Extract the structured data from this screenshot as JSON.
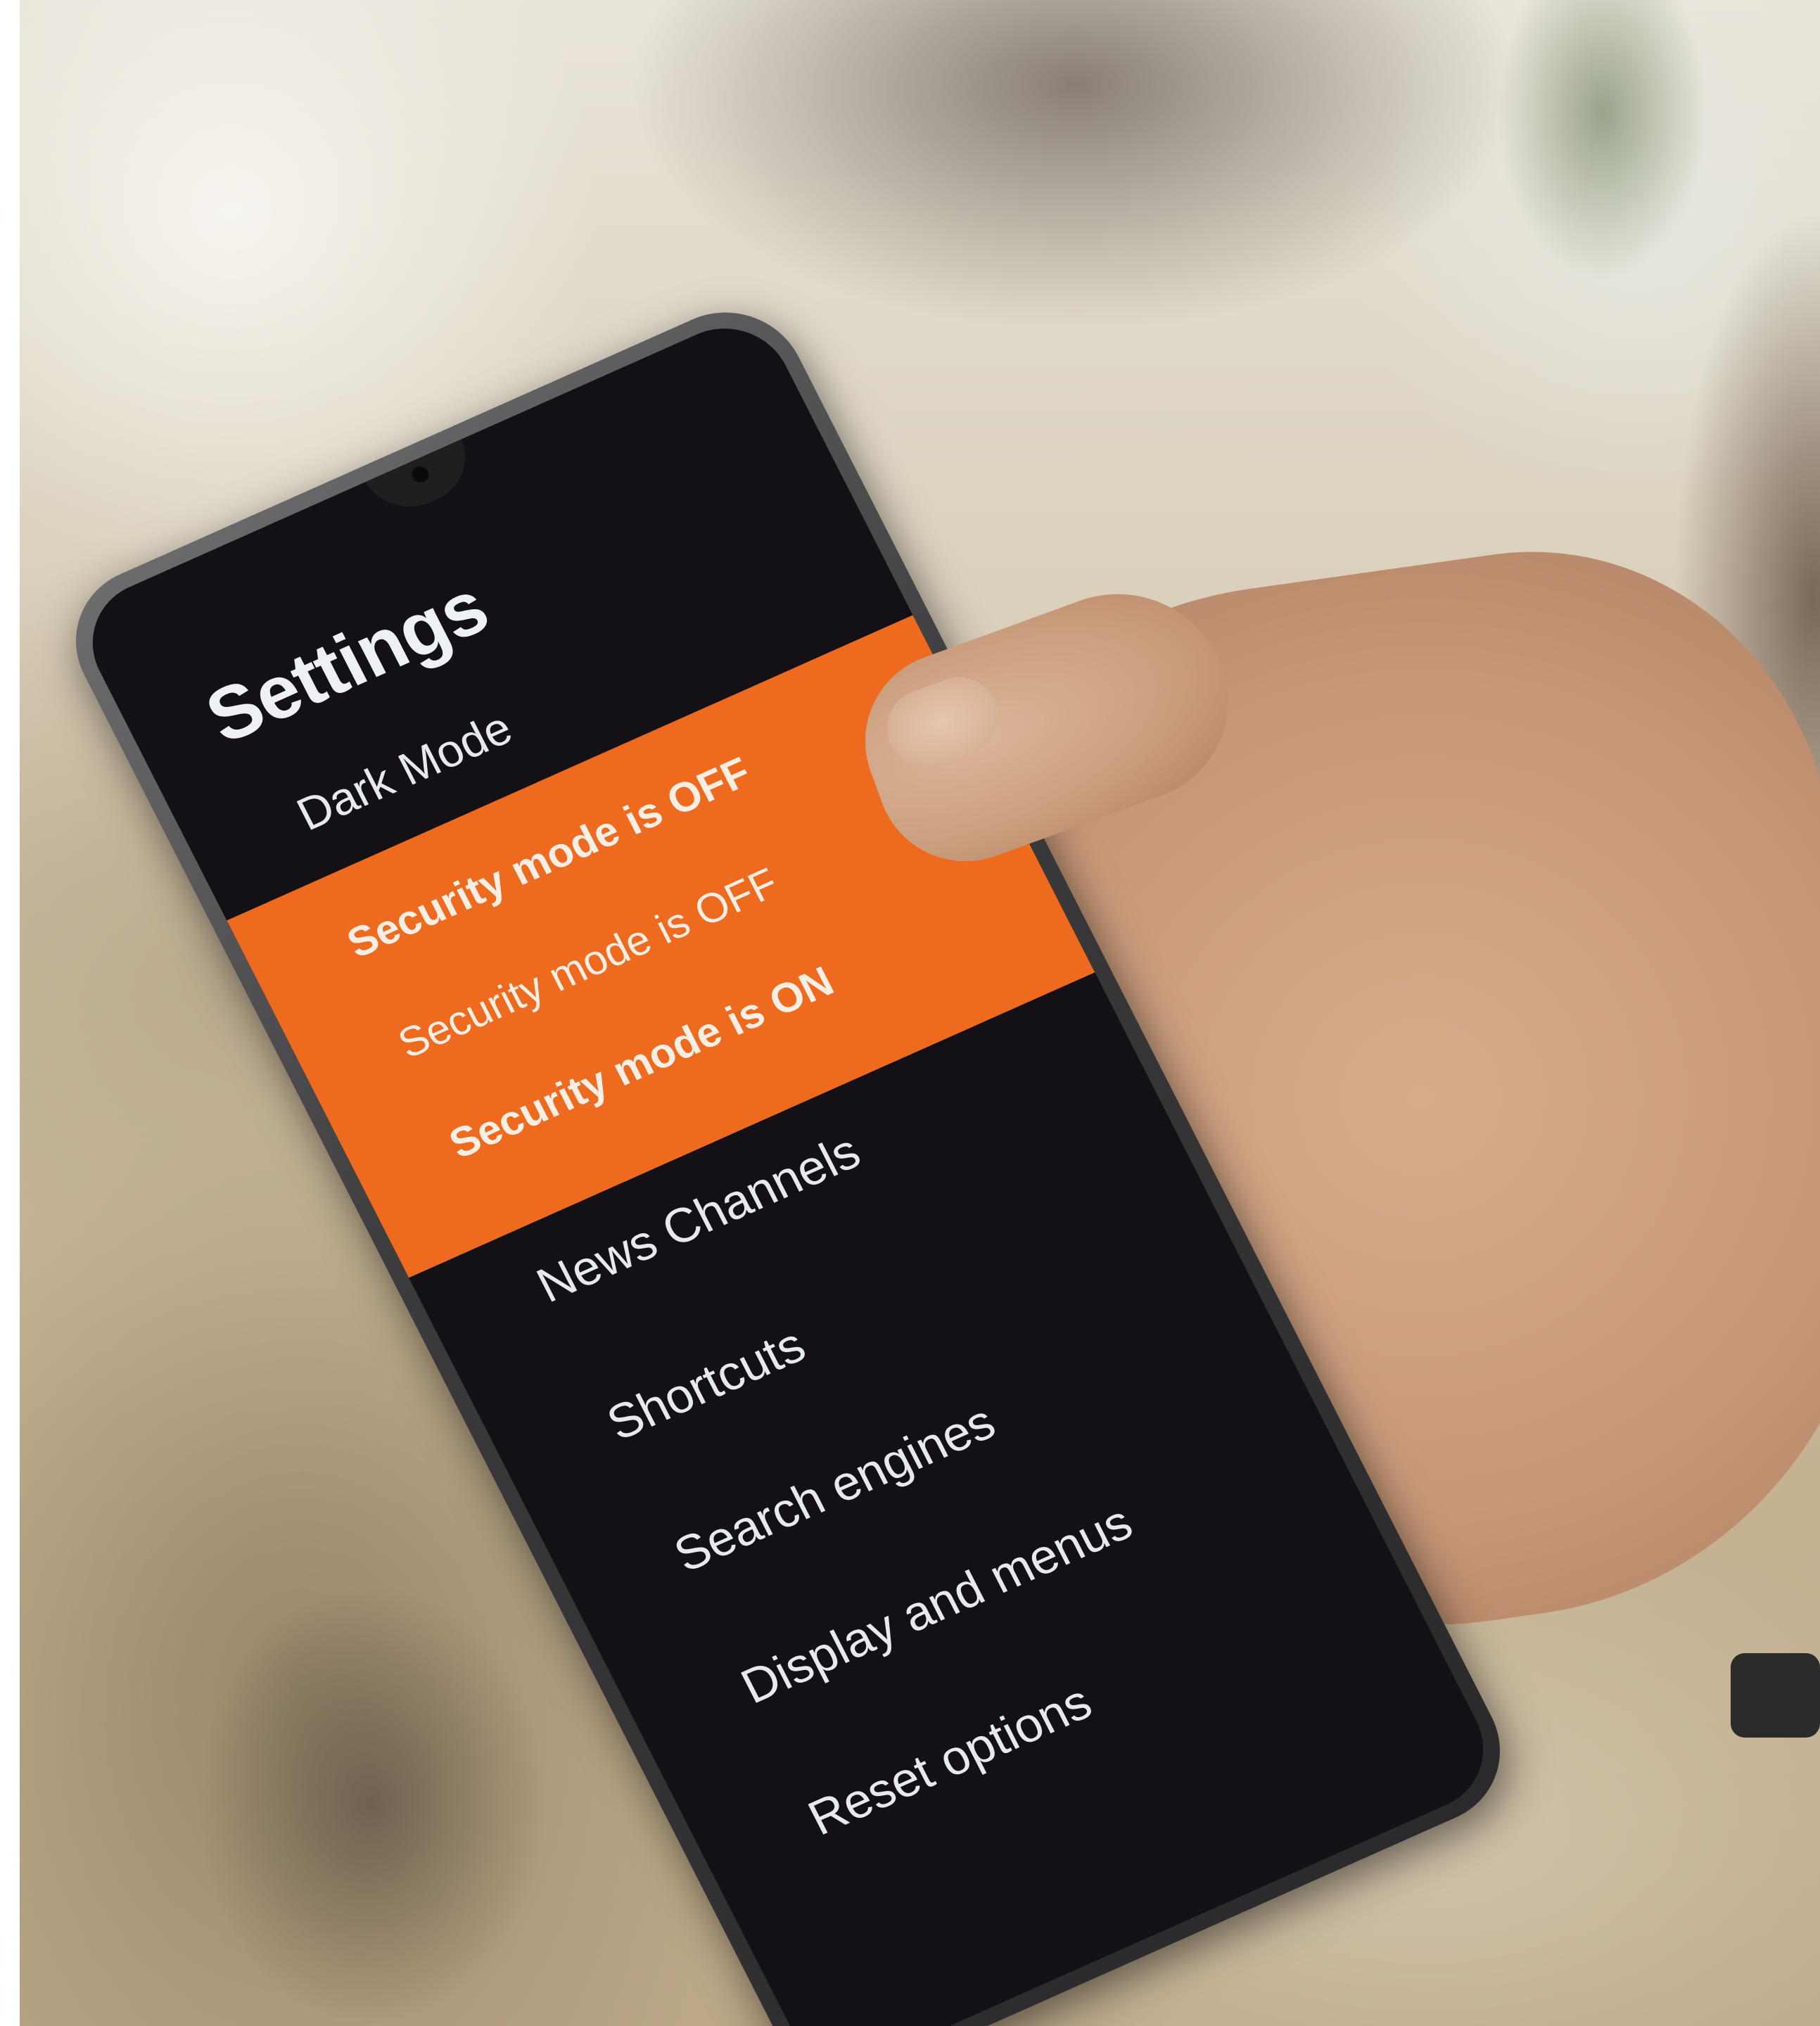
{
  "screen": {
    "title": "Settings",
    "accent_color": "#ed6a1f",
    "background_color": "#131115",
    "menu": {
      "dark_mode": "Dark Mode",
      "security_status": [
        "Security mode is OFF",
        "Security mode is OFF",
        "Security mode is ON"
      ],
      "news_channels": "News Channels",
      "shortcuts": "Shortcuts",
      "search_engines": "Search engines",
      "display_and_menus": "Display and menus",
      "reset_options": "Reset options"
    }
  }
}
